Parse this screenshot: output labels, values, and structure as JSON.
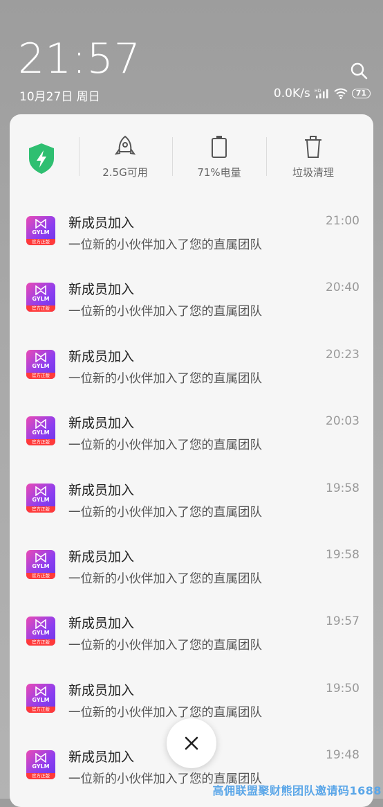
{
  "status": {
    "time": "21:57",
    "date": "10月27日 周日",
    "net_speed": "0.0K/s",
    "battery_level": "71"
  },
  "quick_tiles": [
    {
      "icon": "shield-bolt-icon"
    },
    {
      "icon": "rocket-icon",
      "label": "2.5G可用"
    },
    {
      "icon": "battery-icon",
      "label": "71%电量"
    },
    {
      "icon": "trash-icon",
      "label": "垃圾清理"
    }
  ],
  "app_icon": {
    "text": "GYLM",
    "tag": "官方正版"
  },
  "notifications": [
    {
      "title": "新成员加入",
      "body": "一位新的小伙伴加入了您的直属团队",
      "time": "21:00"
    },
    {
      "title": "新成员加入",
      "body": "一位新的小伙伴加入了您的直属团队",
      "time": "20:40"
    },
    {
      "title": "新成员加入",
      "body": "一位新的小伙伴加入了您的直属团队",
      "time": "20:23"
    },
    {
      "title": "新成员加入",
      "body": "一位新的小伙伴加入了您的直属团队",
      "time": "20:03"
    },
    {
      "title": "新成员加入",
      "body": "一位新的小伙伴加入了您的直属团队",
      "time": "19:58"
    },
    {
      "title": "新成员加入",
      "body": "一位新的小伙伴加入了您的直属团队",
      "time": "19:58"
    },
    {
      "title": "新成员加入",
      "body": "一位新的小伙伴加入了您的直属团队",
      "time": "19:57"
    },
    {
      "title": "新成员加入",
      "body": "一位新的小伙伴加入了您的直属团队",
      "time": "19:50"
    },
    {
      "title": "新成员加入",
      "body": "一位新的小伙伴加入了您的直属团队",
      "time": "19:48"
    }
  ],
  "watermark": "高佣联盟聚财熊团队邀请码1688",
  "colors": {
    "accent_green": "#2fbf71",
    "app_gradient_start": "#e94bb5",
    "app_gradient_end": "#6a35e8",
    "watermark": "#5aa6e8"
  }
}
